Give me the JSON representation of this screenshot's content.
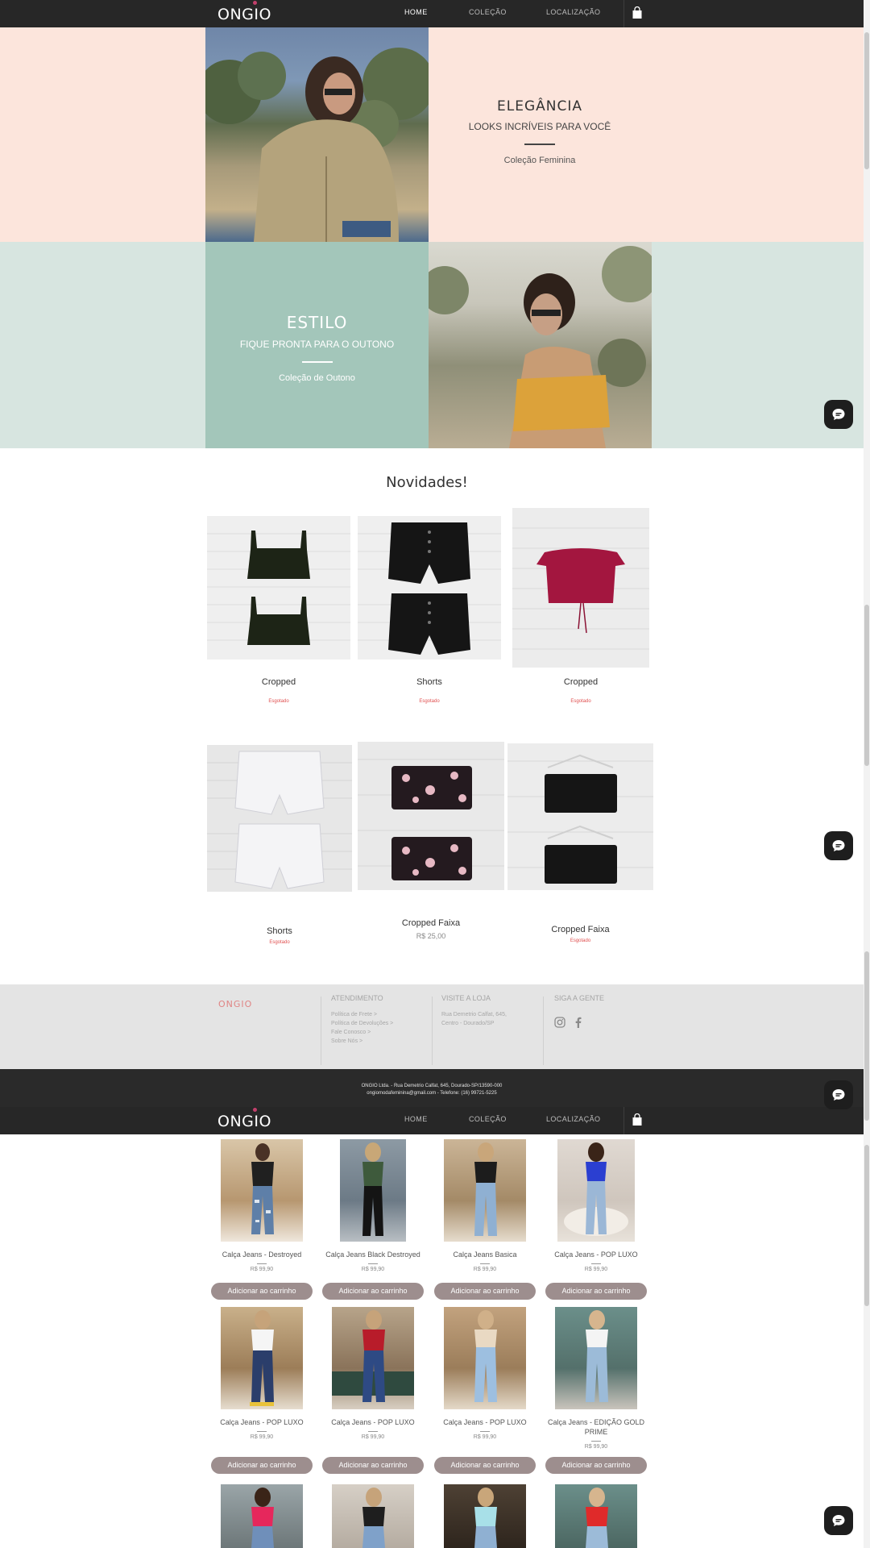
{
  "brand": {
    "name": "ONGIO"
  },
  "nav": {
    "home": "HOME",
    "colecao": "COLEÇÃO",
    "localizacao": "LOCALIZAÇÃO"
  },
  "hero1": {
    "title": "ELEGÂNCIA",
    "subtitle": "LOOKS INCRÍVEIS PARA VOCÊ",
    "link": "Coleção Feminina"
  },
  "hero2": {
    "title": "ESTILO",
    "subtitle": "FIQUE PRONTA PARA O OUTONO",
    "link": "Coleção de Outono"
  },
  "novidades": {
    "title": "Novidades!",
    "products": [
      {
        "name": "Cropped",
        "status": "Esgotado"
      },
      {
        "name": "Shorts",
        "status": "Esgotado"
      },
      {
        "name": "Cropped",
        "status": "Esgotado"
      },
      {
        "name": "Shorts",
        "status": "Esgotado"
      },
      {
        "name": "Cropped Faixa",
        "status": "R$ 25,00"
      },
      {
        "name": "Cropped Faixa",
        "status": "Esgotado"
      }
    ]
  },
  "footer": {
    "logo": "ONGIO",
    "atendimento": {
      "title": "ATENDIMENTO",
      "links": [
        "Política de Frete >",
        "Política de Devoluções >",
        "Fale Conosco >",
        "Sobre Nós >"
      ]
    },
    "visite": {
      "title": "VISITE A LOJA",
      "lines": [
        "Rua Demetrio Calfat, 645,",
        "Centro - Dourado/SP"
      ]
    },
    "siga": {
      "title": "SIGA A GENTE",
      "icons": [
        "instagram-icon",
        "facebook-icon"
      ]
    }
  },
  "bottom": {
    "line1": "ONGIO Ltda. -  Rua Demetrio Calfat, 645, Dourado-SP/13590-000",
    "line2": "ongiomodafeminina@gmail.com -  Telefone: (16) 99721-5225"
  },
  "catalog": {
    "add_label": "Adicionar ao carrinho",
    "items": [
      {
        "name": "Calça Jeans - Destroyed",
        "price": "R$ 99,90"
      },
      {
        "name": "Calça Jeans Black Destroyed",
        "price": "R$ 99,90"
      },
      {
        "name": "Calça Jeans Basica",
        "price": "R$ 99,90"
      },
      {
        "name": "Calça Jeans - POP LUXO",
        "price": "R$ 99,90"
      },
      {
        "name": "Calça Jeans - POP LUXO",
        "price": "R$ 99,90"
      },
      {
        "name": "Calça Jeans - POP LUXO",
        "price": "R$ 99,90"
      },
      {
        "name": "Calça Jeans - POP LUXO",
        "price": "R$ 99,90"
      },
      {
        "name": "Calça Jeans - EDIÇÃO GOLD PRIME",
        "price": "R$ 99,90"
      }
    ]
  },
  "colors": {
    "nav_bg": "#272727",
    "hero1_bg": "#fce5dc",
    "hero2_bg": "#d7e5e0",
    "teal": "#a3c6ba",
    "sold_out": "#e05050",
    "button": "#9d8e8e"
  }
}
